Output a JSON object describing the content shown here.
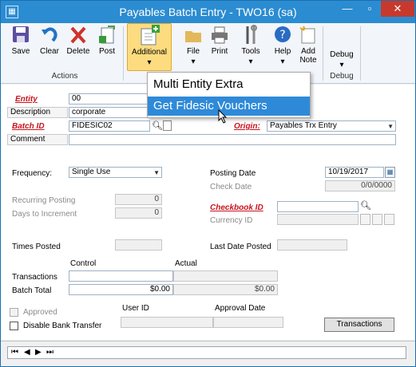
{
  "window": {
    "title": "Payables Batch Entry  -  TWO16 (sa)",
    "controls": {
      "minimize": "—",
      "restore": "▫",
      "close": "✕"
    }
  },
  "ribbon": {
    "buttons": {
      "save": "Save",
      "clear": "Clear",
      "delete": "Delete",
      "post": "Post",
      "additional": "Additional",
      "file": "File",
      "print": "Print",
      "tools": "Tools",
      "help": "Help",
      "add_note_1": "Add",
      "add_note_2": "Note",
      "debug": "Debug"
    },
    "groups": {
      "actions": "Actions",
      "debug": "Debug"
    }
  },
  "menu": {
    "items": [
      "Multi Entity Extra",
      "Get Fidesic Vouchers"
    ]
  },
  "form": {
    "entity_label": "Entity",
    "entity_value": "00",
    "description_label": "Description",
    "description_value": "corporate",
    "batch_id_label": "Batch ID",
    "batch_id_value": "FIDESIC02",
    "origin_label": "Origin:",
    "origin_value": "Payables Trx Entry",
    "comment_label": "Comment",
    "comment_value": "",
    "frequency_label": "Frequency:",
    "frequency_value": "Single Use",
    "recurring_posting_label": "Recurring Posting",
    "recurring_posting_value": "0",
    "days_to_increment_label": "Days to Increment",
    "days_to_increment_value": "0",
    "times_posted_label": "Times Posted",
    "times_posted_value": "",
    "posting_date_label": "Posting Date",
    "posting_date_value": "10/19/2017",
    "check_date_label": "Check Date",
    "check_date_value": "0/0/0000",
    "checkbook_id_label": "Checkbook ID",
    "checkbook_id_value": "",
    "currency_id_label": "Currency ID",
    "currency_id_value": "",
    "last_date_posted_label": "Last Date Posted",
    "last_date_posted_value": "",
    "control_header": "Control",
    "actual_header": "Actual",
    "transactions_label": "Transactions",
    "transactions_control": "",
    "transactions_actual": "",
    "batch_total_label": "Batch Total",
    "batch_total_control": "$0.00",
    "batch_total_actual": "$0.00",
    "approved_label": "Approved",
    "disable_bank_transfer_label": "Disable Bank Transfer",
    "user_id_label": "User ID",
    "approval_date_label": "Approval Date",
    "transactions_button": "Transactions"
  },
  "navigation": {
    "first": "⏮",
    "prev": "◀",
    "next": "▶",
    "last": "⏭"
  }
}
